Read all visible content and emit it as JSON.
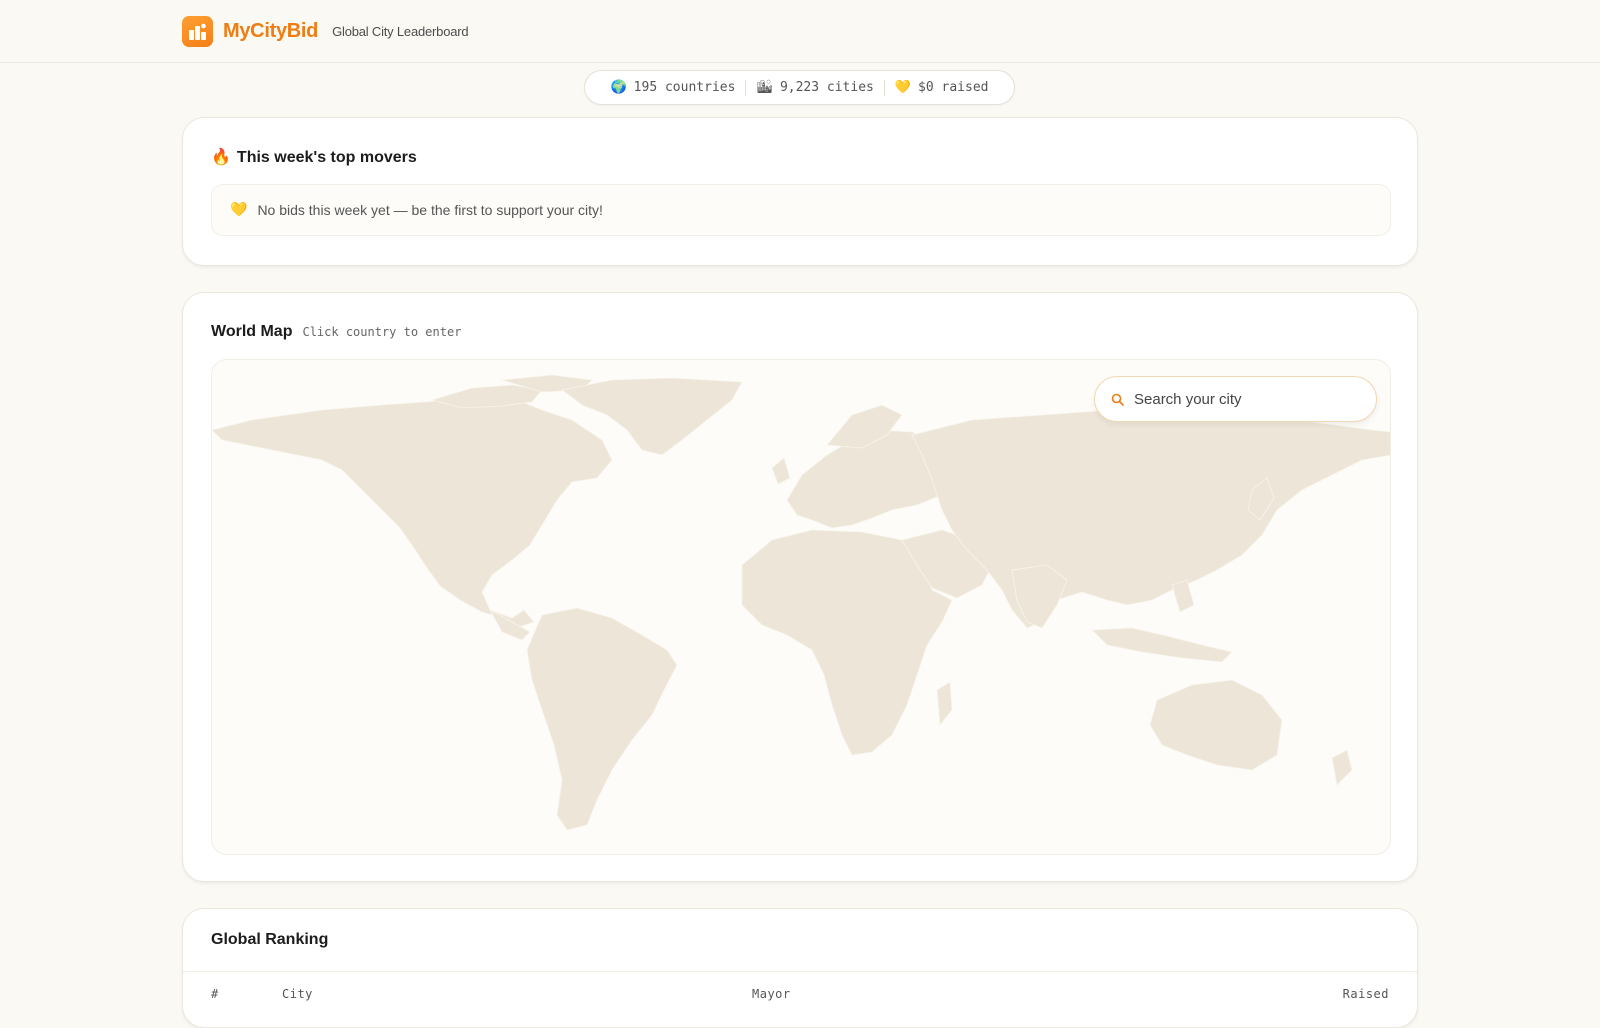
{
  "header": {
    "brand": "MyCityBid",
    "subtitle": "Global City Leaderboard",
    "logo_icon": "city-chart-icon"
  },
  "stats": [
    {
      "icon": "🌍",
      "icon_name": "globe-icon",
      "label": "195 countries"
    },
    {
      "icon": "🏙",
      "icon_name": "cityscape-icon",
      "label": "9,223 cities"
    },
    {
      "icon": "💛",
      "icon_name": "heart-icon",
      "label": "$0 raised"
    }
  ],
  "movers": {
    "icon": "🔥",
    "title": "This week's top movers",
    "empty_icon": "💛",
    "empty_text": "No bids this week yet — be the first to support your city!"
  },
  "map": {
    "title": "World Map",
    "hint": "Click country to enter",
    "search_placeholder": "Search your city"
  },
  "ranking": {
    "title": "Global Ranking",
    "columns": [
      "#",
      "City",
      "Mayor",
      "Raised"
    ]
  },
  "colors": {
    "accent": "#ef7d13",
    "background": "#fbf9f3",
    "land": "#ede6d8"
  }
}
